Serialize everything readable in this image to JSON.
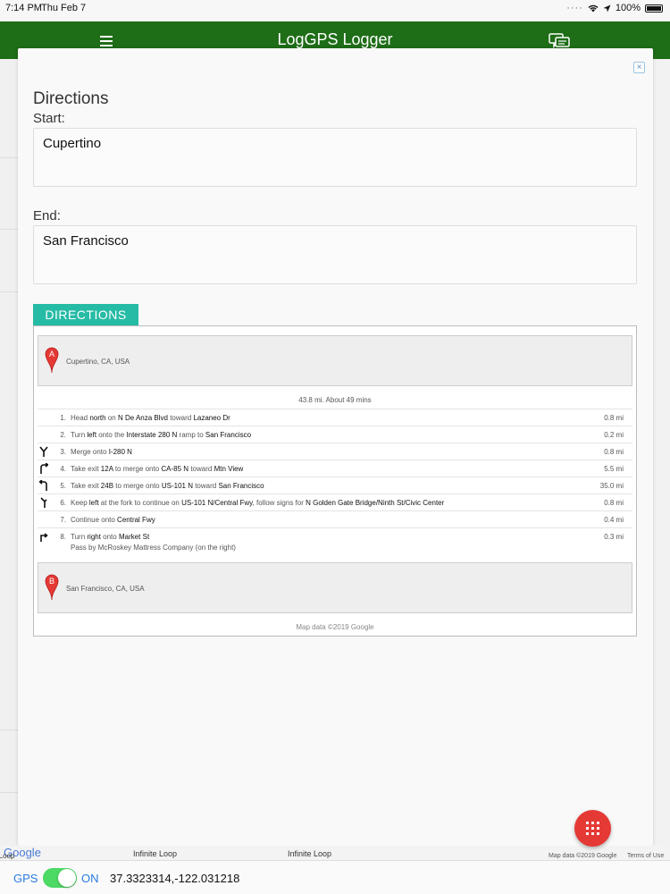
{
  "status_bar": {
    "time": "7:14 PM",
    "date": "Thu Feb 7",
    "battery": "100%"
  },
  "app": {
    "title": "LogGPS Logger"
  },
  "modal": {
    "title": "Directions",
    "start_label": "Start:",
    "start_value": "Cupertino",
    "end_label": "End:",
    "end_value": "San Francisco",
    "directions_button": "DIRECTIONS",
    "close_glyph": "×"
  },
  "route": {
    "start_address": "Cupertino, CA, USA",
    "end_address": "San Francisco, CA, USA",
    "start_marker": "A",
    "end_marker": "B",
    "summary": "43.8 mi. About 49 mins",
    "map_data": "Map data ©2019 Google",
    "steps": [
      {
        "num": "1.",
        "parts": [
          "Head ",
          "north",
          " on ",
          "N De Anza Blvd",
          " toward ",
          "Lazaneo Dr"
        ],
        "distance": "0.8 mi",
        "icon": "none"
      },
      {
        "num": "2.",
        "parts": [
          "Turn ",
          "left",
          " onto the ",
          "Interstate 280 N",
          " ramp to ",
          "San Francisco"
        ],
        "distance": "0.2 mi",
        "icon": "none"
      },
      {
        "num": "3.",
        "parts": [
          "Merge onto ",
          "I-280 N"
        ],
        "distance": "0.8 mi",
        "icon": "merge-icon"
      },
      {
        "num": "4.",
        "parts": [
          "Take exit ",
          "12A",
          " to merge onto ",
          "CA-85 N",
          " toward ",
          "Mtn View"
        ],
        "distance": "5.5 mi",
        "icon": "ramp-right-icon"
      },
      {
        "num": "5.",
        "parts": [
          "Take exit ",
          "24B",
          " to merge onto ",
          "US-101 N",
          " toward ",
          "San Francisco"
        ],
        "distance": "35.0 mi",
        "icon": "ramp-left-icon"
      },
      {
        "num": "6.",
        "parts": [
          "Keep ",
          "left",
          " at the fork to continue on ",
          "US-101 N/Central Fwy",
          ", follow signs for ",
          "N Golden Gate Bridge/Ninth St/Civic Center"
        ],
        "distance": "0.8 mi",
        "icon": "fork-left-icon"
      },
      {
        "num": "7.",
        "parts": [
          "Continue onto ",
          "Central Fwy"
        ],
        "distance": "0.4 mi",
        "icon": "none"
      },
      {
        "num": "8.",
        "parts": [
          "Turn ",
          "right",
          " onto ",
          "Market St"
        ],
        "sub": "Pass by McRoskey Mattress Company (on the right)",
        "distance": "0.3 mi",
        "icon": "turn-right-icon"
      }
    ]
  },
  "map": {
    "google_logo": "Google",
    "left_fragment": "e Loop",
    "label_1": "Infinite Loop",
    "label_2": "Infinite Loop",
    "map_data": "Map data ©2019 Google",
    "terms": "Terms of Use"
  },
  "gps_bar": {
    "gps_label": "GPS",
    "toggle_state": "ON",
    "coordinates": "37.3323314,-122.031218"
  },
  "colors": {
    "header": "#1e6d17",
    "accent": "#26bba5",
    "fab": "#e53935",
    "toggle_on": "#4cd964",
    "link_blue": "#2a7be0",
    "marker_red": "#e53935"
  }
}
